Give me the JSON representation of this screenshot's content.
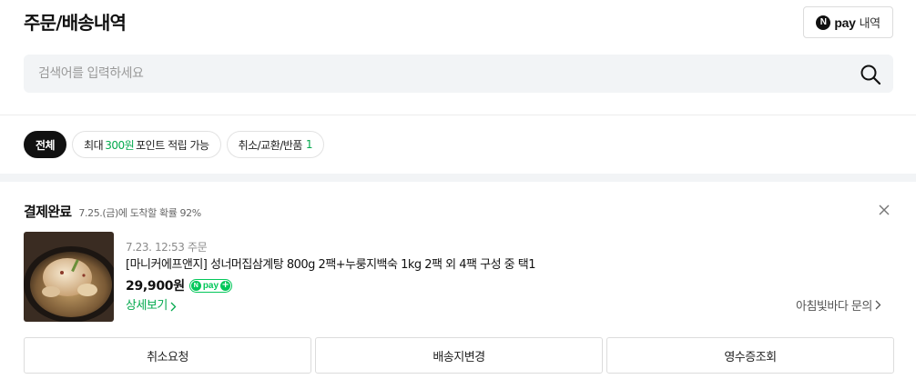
{
  "header": {
    "title": "주문/배송내역",
    "npay_button": {
      "logo": "N",
      "brand": "pay",
      "label": "내역"
    }
  },
  "search": {
    "placeholder": "검색어를 입력하세요",
    "value": ""
  },
  "filters": [
    {
      "label": "전체",
      "active": true
    },
    {
      "prefix": "최대 ",
      "highlight": "300원",
      "suffix": " 포인트 적립 가능",
      "active": false
    },
    {
      "label": "취소/교환/반품",
      "count": "1",
      "active": false
    }
  ],
  "order": {
    "status": "결제완료",
    "status_desc": "7.25.(금)에 도착할 확률 92%",
    "date": "7.23. 12:53 주문",
    "product_name": "[마니커에프앤지] 성너머집삼계탕 800g 2팩+누룽지백숙 1kg 2팩 외 4팩 구성 중 택1",
    "price": "29,900원",
    "payment_badge": {
      "logo": "N",
      "brand": "pay",
      "plus": "+"
    },
    "detail_link": "상세보기",
    "seller_inquiry": "아침빛바다 문의",
    "actions": [
      "취소요청",
      "배송지변경",
      "영수증조회"
    ]
  },
  "colors": {
    "accent_green": "#03c75a",
    "text_green": "#03a94d",
    "chip_active_bg": "#111111",
    "search_bg": "#f2f4f6"
  }
}
